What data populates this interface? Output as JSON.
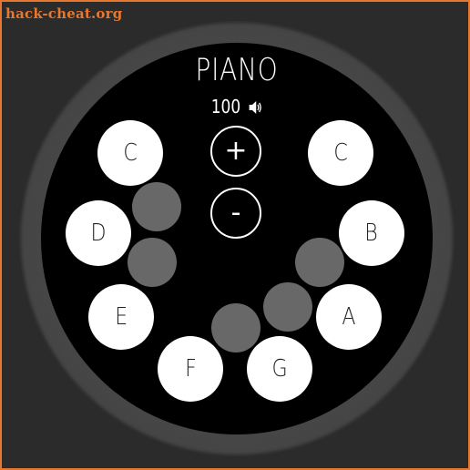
{
  "watermark": "hack-cheat.org",
  "app": {
    "title": "PIANO"
  },
  "volume": {
    "value": "100",
    "icon": "speaker-icon"
  },
  "controls": {
    "increase_label": "+",
    "decrease_label": "-"
  },
  "white_keys": [
    {
      "note": "C"
    },
    {
      "note": "C"
    },
    {
      "note": "D"
    },
    {
      "note": "B"
    },
    {
      "note": "E"
    },
    {
      "note": "A"
    },
    {
      "note": "F"
    },
    {
      "note": "G"
    }
  ],
  "colors": {
    "background": "#2b2b2b",
    "bezel": "#444444",
    "screen": "#000000",
    "white_key": "#ffffff",
    "black_key": "#686868",
    "watermark": "#e8772e"
  }
}
